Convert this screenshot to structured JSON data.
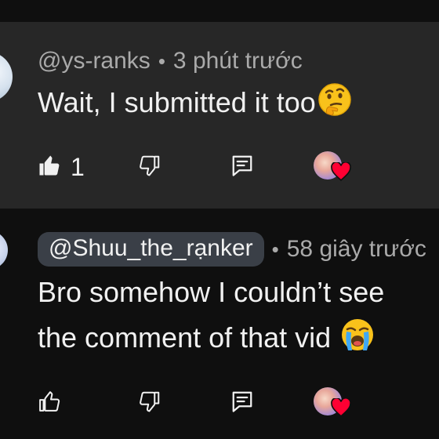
{
  "comments": [
    {
      "author": "@ys-ranks",
      "separator": "•",
      "time": "3 phút trước",
      "text_lines": [
        "Wait, I submitted it too"
      ],
      "emoji": "thinking-face",
      "like_count": "1",
      "liked": true,
      "hearted": true
    },
    {
      "author": "@Shuu_the_rạnker",
      "separator": "•",
      "time": "58 giây trước",
      "text_lines": [
        "Bro somehow I couldn’t see",
        "the comment of that vid"
      ],
      "emoji": "loudly-crying-face",
      "like_count": "",
      "liked": false,
      "hearted": true
    }
  ],
  "colors": {
    "background": "#0f0f0f",
    "highlighted_comment": "#272727",
    "primary_text": "#f1f1f1",
    "secondary_text": "#aaaaaa",
    "author_chip": "#3a3f47",
    "heart": "#ff0033"
  }
}
